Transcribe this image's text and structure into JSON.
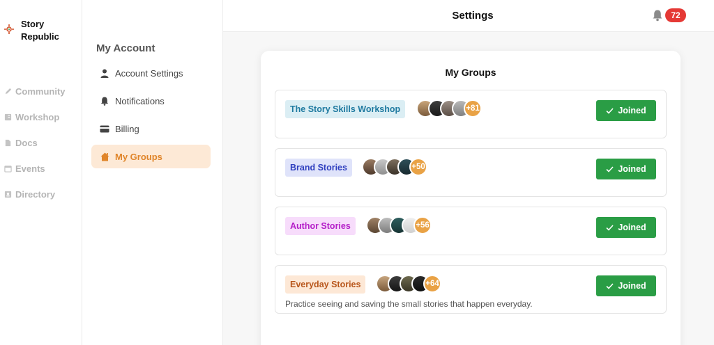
{
  "app": {
    "brand_name": "Story Republic",
    "nav": [
      {
        "label": "Community",
        "icon": "pencil-icon"
      },
      {
        "label": "Workshop",
        "icon": "book-icon"
      },
      {
        "label": "Docs",
        "icon": "document-icon"
      },
      {
        "label": "Events",
        "icon": "calendar-icon"
      },
      {
        "label": "Directory",
        "icon": "contact-card-icon"
      }
    ]
  },
  "topbar": {
    "title": "Settings",
    "notification_count": "72"
  },
  "settings_nav": {
    "heading": "My Account",
    "items": [
      {
        "label": "Account Settings",
        "icon": "user-icon"
      },
      {
        "label": "Notifications",
        "icon": "bell-icon"
      },
      {
        "label": "Billing",
        "icon": "credit-card-icon"
      },
      {
        "label": "My Groups",
        "icon": "home-icon",
        "active": true
      }
    ]
  },
  "groups_panel": {
    "title": "My Groups",
    "groups": [
      {
        "name": "The Story Skills Workshop",
        "more_members": "+81",
        "button": "Joined",
        "description": "",
        "tag_bg": "#dbeef4",
        "tag_color": "#1f7aa0"
      },
      {
        "name": "Brand Stories",
        "more_members": "+50",
        "button": "Joined",
        "description": "",
        "tag_bg": "#dfe3fa",
        "tag_color": "#2f3fbf"
      },
      {
        "name": "Author Stories",
        "more_members": "+56",
        "button": "Joined",
        "description": "",
        "tag_bg": "#f7dcfb",
        "tag_color": "#b520c9"
      },
      {
        "name": "Everyday Stories",
        "more_members": "+64",
        "button": "Joined",
        "description": "Practice seeing and saving the small stories that happen everyday.",
        "tag_bg": "#fde8d6",
        "tag_color": "#b8561b"
      }
    ]
  },
  "colors": {
    "accent": "#e0852a",
    "joined_button": "#2a9d45",
    "badge": "#e53935",
    "more_members": "#e9a245"
  }
}
